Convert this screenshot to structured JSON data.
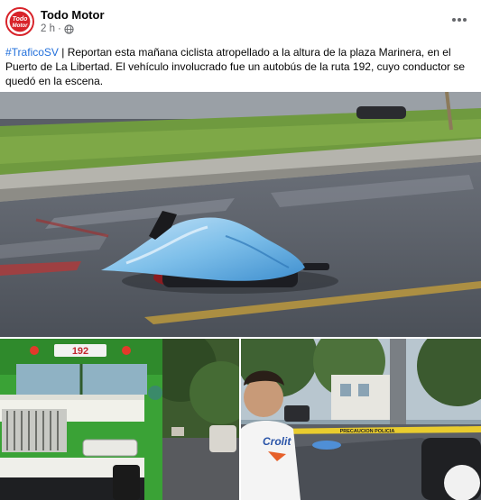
{
  "post": {
    "page_name": "Todo Motor",
    "time": "2 h",
    "separator": "·",
    "hashtag": "#TraficoSV",
    "body": " | Reportan esta mañana ciclista atropellado a la altura de la plaza Marinera, en el Puerto de La Libertad. El vehículo involucrado fue un autobús de la ruta 192, cuyo conductor se quedó en la escena."
  },
  "avatar": {
    "logo_line1": "Todo",
    "logo_line2": "Motor"
  },
  "icons": {
    "globe": "globe-icon",
    "more": "more-options-icon"
  },
  "photos": {
    "bus_route_sign": "192",
    "caution_tape": "PRECAUCION POLICIA",
    "shirt_text": "Crolit"
  },
  "colors": {
    "hashtag": "#216fdb",
    "brand_red": "#d8232a",
    "meta_gray": "#65676b"
  }
}
